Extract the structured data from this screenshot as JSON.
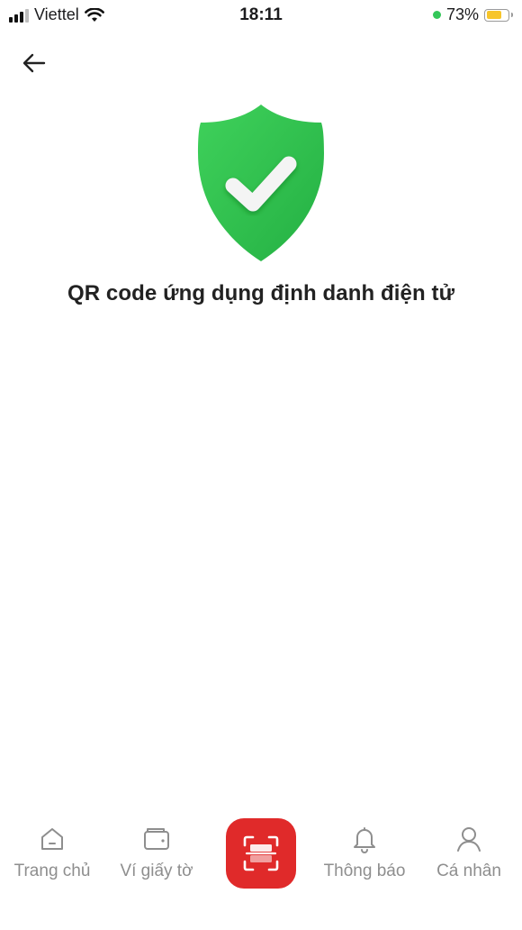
{
  "status_bar": {
    "carrier": "Viettel",
    "time": "18:11",
    "battery_percent": "73%",
    "battery_level": 0.73
  },
  "header": {
    "back_icon": "arrow-left-icon"
  },
  "main": {
    "badge_icon": "shield-check-icon",
    "title": "QR code ứng dụng định danh điện tử"
  },
  "tab_bar": {
    "tabs": [
      {
        "label": "Trang chủ",
        "icon": "home-icon"
      },
      {
        "label": "Ví giấy tờ",
        "icon": "wallet-icon"
      },
      {
        "label": "Thông báo",
        "icon": "bell-icon"
      },
      {
        "label": "Cá nhân",
        "icon": "person-icon"
      }
    ],
    "scan_icon": "qr-scan-icon"
  },
  "colors": {
    "accent": "#e02a2a",
    "shield_green": "#2fbf4e",
    "tab_inactive": "#8e8e8e"
  }
}
